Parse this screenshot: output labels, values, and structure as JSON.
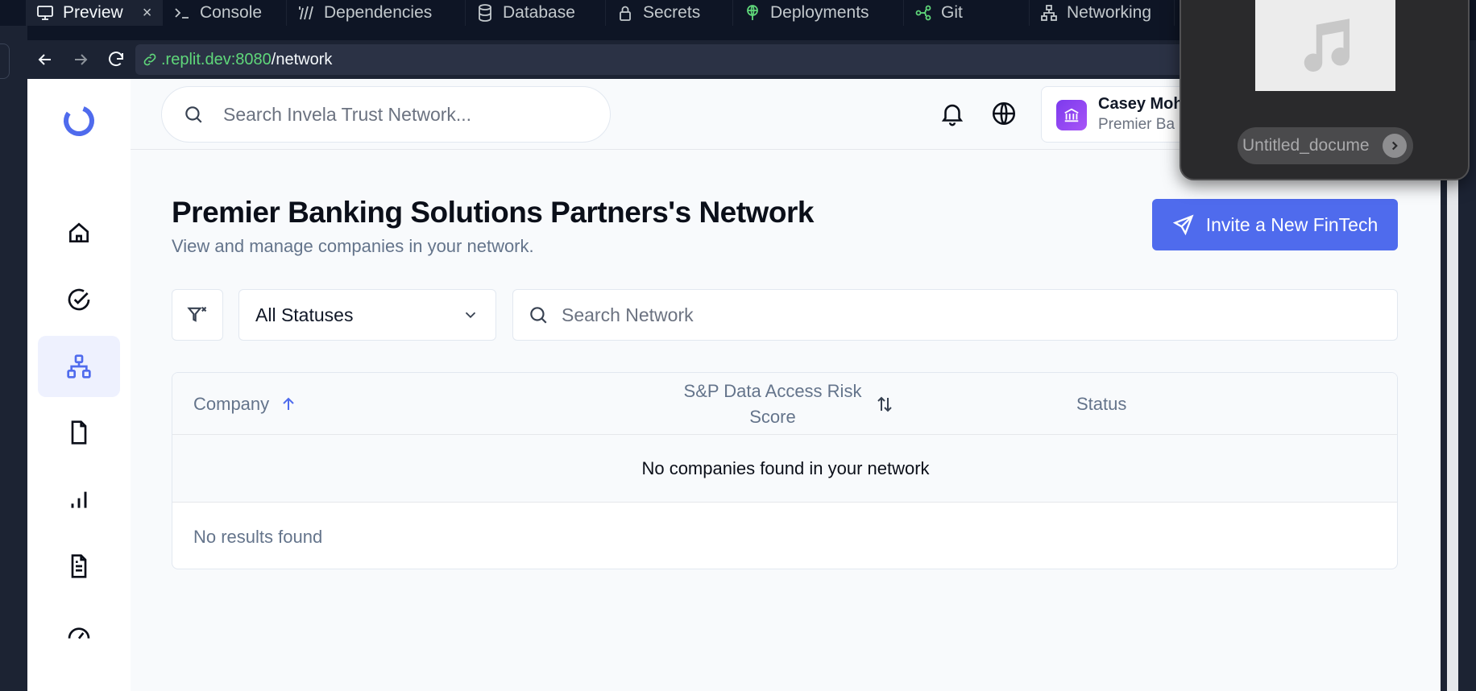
{
  "ide_tabs": [
    {
      "label": "Preview",
      "icon": "monitor-icon",
      "active": true,
      "closable": true
    },
    {
      "label": "Console",
      "icon": "terminal-icon"
    },
    {
      "label": "Dependencies",
      "icon": "dependencies-icon"
    },
    {
      "label": "Database",
      "icon": "database-icon"
    },
    {
      "label": "Secrets",
      "icon": "lock-icon"
    },
    {
      "label": "Deployments",
      "icon": "deployments-icon"
    },
    {
      "label": "Git",
      "icon": "git-icon"
    },
    {
      "label": "Networking",
      "icon": "networking-icon"
    }
  ],
  "tab_close_glyph": "×",
  "urlbar": {
    "host": ".replit.dev:8080",
    "path": "/network"
  },
  "header": {
    "search_placeholder": "Search Invela Trust Network...",
    "user_name": "Casey Moh",
    "user_org": "Premier Ba"
  },
  "page": {
    "title": "Premier Banking Solutions Partners's Network",
    "subtitle": "View and manage companies in your network.",
    "invite_label": "Invite a New FinTech"
  },
  "filters": {
    "status_selected": "All Statuses",
    "search_placeholder": "Search Network"
  },
  "table": {
    "columns": [
      "Company",
      "S&P Data Access Risk Score",
      "Status"
    ],
    "empty_message": "No companies found in your network",
    "no_results": "No results found"
  },
  "popup": {
    "file_name": "Untitled_docume"
  },
  "colors": {
    "accent": "#4f6bed",
    "ide_bg": "#0e1525",
    "url_host": "#5fd77a"
  }
}
